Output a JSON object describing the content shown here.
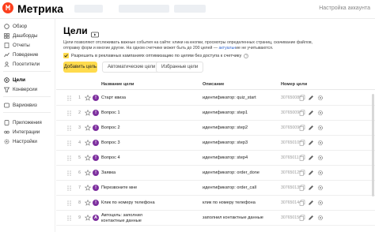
{
  "header": {
    "logo_text": "Метрика",
    "settings_link": "Настройка аккаунта"
  },
  "sidebar": {
    "items": [
      {
        "label": "Обзор",
        "icon": "overview-icon"
      },
      {
        "label": "Дашборды",
        "icon": "dashboards-icon"
      },
      {
        "label": "Отчеты",
        "icon": "reports-icon"
      },
      {
        "label": "Поведение",
        "icon": "behavior-icon"
      },
      {
        "label": "Посетители",
        "icon": "visitors-icon"
      },
      {
        "label": "Цели",
        "icon": "goals-icon",
        "active": true
      },
      {
        "label": "Конверсии",
        "icon": "conversions-icon"
      },
      {
        "label": "Вариоквиз",
        "icon": "varioquiz-icon"
      },
      {
        "label": "Приложения",
        "icon": "apps-icon"
      },
      {
        "label": "Интеграции",
        "icon": "integrations-icon"
      },
      {
        "label": "Настройки",
        "icon": "settings-icon"
      }
    ]
  },
  "main": {
    "title": "Цели",
    "description_part1": "Цели позволяют отслеживать важные события на сайте: клики на кнопки, просмотры определенных страниц, скачивание файлов, отправку форм и многие другие. На одном счетчике может быть до 200 целей —",
    "description_link": "актуальн",
    "description_part2": "ие не учитываются.",
    "checkbox_label": "Разрешить в рекламных кампаниях оптимизацию по целям без доступа к счетчику",
    "add_button": "Добавить цель",
    "tab_auto": "Автоматические цели",
    "tab_favorite": "Избранные цели",
    "table": {
      "columns": [
        "Название цели",
        "Описание",
        "Номер цели"
      ],
      "rows": [
        {
          "num": "1",
          "name": "Старт квиза",
          "condition": "идентификатор: quiz_start",
          "id": "307650088"
        },
        {
          "num": "2",
          "name": "Вопрос 1",
          "condition": "идентификатор: step1",
          "id": "307650098"
        },
        {
          "num": "3",
          "name": "Вопрос 2",
          "condition": "идентификатор: step2",
          "id": "307650096"
        },
        {
          "num": "4",
          "name": "Вопрос 3",
          "condition": "идентификатор: step3",
          "id": "307650109"
        },
        {
          "num": "5",
          "name": "Вопрос 4",
          "condition": "идентификатор: step4",
          "id": "307650117"
        },
        {
          "num": "6",
          "name": "Заявка",
          "condition": "идентификатор: order_done",
          "id": "307650125"
        },
        {
          "num": "7",
          "name": "Перезвоните мне",
          "condition": "идентификатор: order_call",
          "id": "307650135"
        },
        {
          "num": "8",
          "name": "Клик по номеру телефона",
          "condition": "клик по номеру телефона",
          "id": "307650144"
        },
        {
          "num": "9",
          "name": "Автоцель: заполнил контактные данные",
          "condition": "заполнил контактные данные",
          "id": "307650156"
        }
      ]
    }
  },
  "colors": {
    "accent_yellow": "#ffdb4d",
    "goal_icon_purple": "#7d2f9e",
    "logo_red": "#fc3f1d",
    "link_blue": "#3366cc"
  }
}
